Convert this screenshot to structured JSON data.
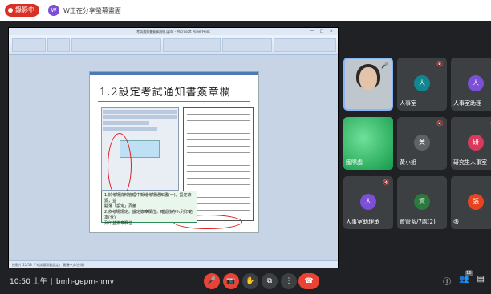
{
  "topbar": {
    "recording_label": "錄影中",
    "host_initial": "W",
    "host_text": "W正在分享螢幕畫面"
  },
  "presentation": {
    "window_title": "考試通知書簽章說明.pptx - Microsoft PowerPoint",
    "window_controls": "—  □  ✕",
    "slide_title": "1.2設定考試通知書簽章欄",
    "note_lines": [
      "1.於考場資料管理中新增考場通知書(一)，設定來源，並",
      "  點選「設定」頁籤",
      "2.依考場規定，設定簽章欄位，確認後存入列印範本(含)",
      "  列印並簽章欄位"
    ],
    "statusbar_text": "投影片 12/18  「考試通知書設定」  繁體中文(台灣)"
  },
  "participants": [
    {
      "name": "",
      "type": "camera",
      "mic": "🎤"
    },
    {
      "name": "人事室",
      "initial": "人",
      "color": "#12868f",
      "mic": "🔇"
    },
    {
      "name": "人事室助理",
      "initial": "人",
      "color": "#7b4fd6",
      "mic": ""
    },
    {
      "name": "國際處",
      "type": "green",
      "mic": ""
    },
    {
      "name": "黃小姐",
      "initial": "黃",
      "color": "#5f6368",
      "mic": "🔇"
    },
    {
      "name": "研究生人事室",
      "initial": "研",
      "color": "#d93a5b",
      "mic": "🔇"
    },
    {
      "name": "人事室助理承",
      "initial": "人",
      "color": "#7b4fd6",
      "mic": "🔇"
    },
    {
      "name": "資管系/7處(2)",
      "initial": "資",
      "color": "#2a7a3d",
      "mic": ""
    },
    {
      "name": "張",
      "initial": "張",
      "color": "#e8431f",
      "mic": ""
    }
  ],
  "bottombar": {
    "time": "10:50 上午",
    "meeting_code": "bmh-gepm-hmv",
    "people_count": "16"
  }
}
